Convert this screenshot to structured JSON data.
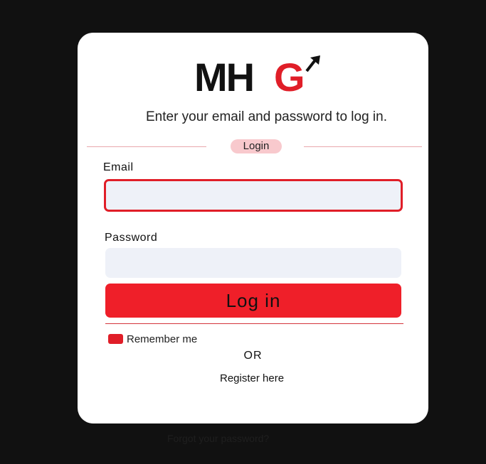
{
  "brand": {
    "logo_text": "MHG",
    "logo_dark_color": "#111111",
    "logo_accent_color": "#e01e28",
    "logo_icon": "arrow-up-right-icon"
  },
  "header": {
    "subtitle": "Enter your email and password to log in."
  },
  "form": {
    "section_label": "Login",
    "email_label": "Email",
    "email_value": "",
    "password_label": "Password",
    "password_value": "",
    "submit_label": "Log in",
    "remember_label": "Remember me",
    "remember_checked": true
  },
  "footer": {
    "or_text": "OR",
    "register_label": "Register here",
    "forgot_label": "Forgot your password?"
  },
  "colors": {
    "background": "#111111",
    "card": "#ffffff",
    "accent": "#ef1f29",
    "input_fill": "#eef1f8",
    "pill": "#f8c9cd"
  }
}
